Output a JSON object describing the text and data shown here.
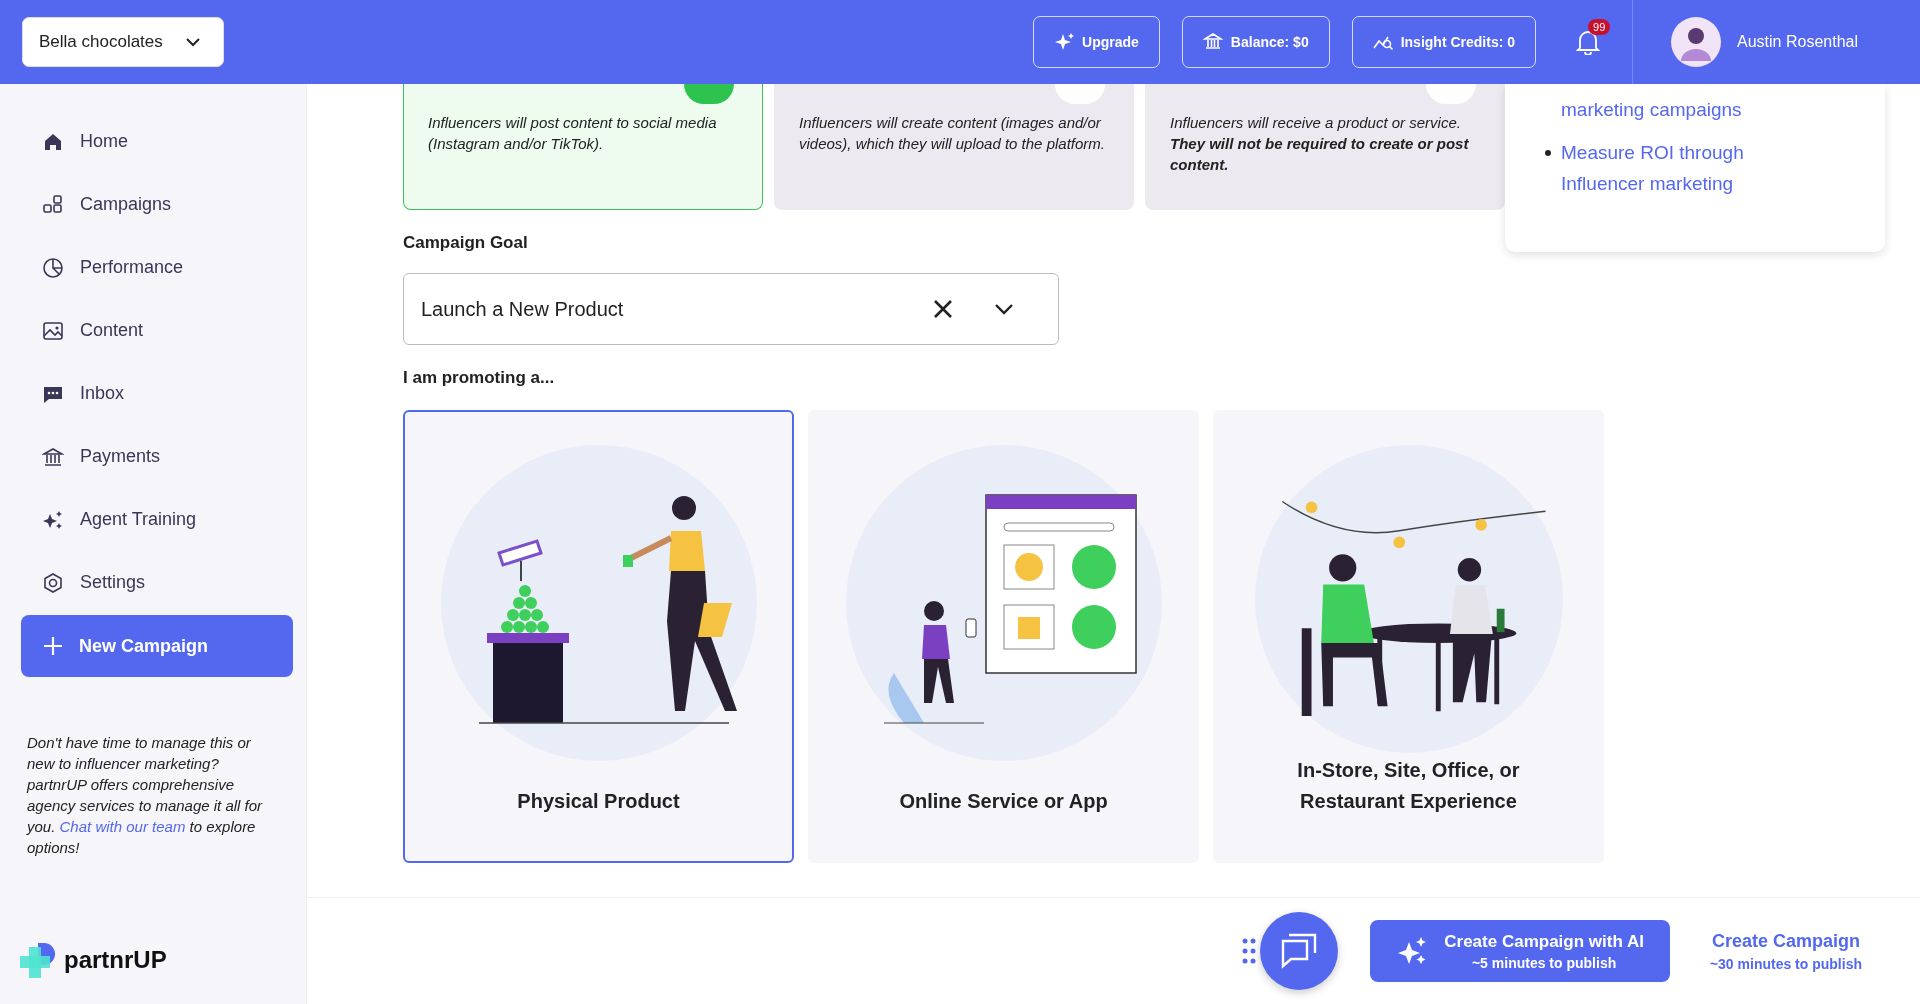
{
  "brand_selector": {
    "value": "Bella chocolates"
  },
  "top_bar": {
    "buttons": [
      {
        "label": "Upgrade",
        "kind": "upgrade"
      },
      {
        "label": "Balance: $0",
        "kind": "balance"
      },
      {
        "label": "Insight Credits: 0",
        "kind": "insight"
      }
    ],
    "notifications": {
      "count": "99"
    },
    "user": {
      "name": "Austin Rosenthal"
    }
  },
  "sidebar": {
    "items": [
      {
        "label": "Home",
        "kind": "home"
      },
      {
        "label": "Campaigns",
        "kind": "campaigns"
      },
      {
        "label": "Performance",
        "kind": "performance"
      },
      {
        "label": "Content",
        "kind": "content"
      },
      {
        "label": "Inbox",
        "kind": "inbox"
      },
      {
        "label": "Payments",
        "kind": "payments"
      },
      {
        "label": "Agent Training",
        "kind": "training"
      },
      {
        "label": "Settings",
        "kind": "settings"
      }
    ],
    "new_campaign": "New Campaign",
    "promo": {
      "text_before": "Don't have time to manage this or new to influencer marketing? partnrUP offers comprehensive agency services to manage it all for you. ",
      "link": "Chat with our team",
      "text_after": " to explore options!"
    },
    "logo": "partnrUP"
  },
  "campaign_types": [
    {
      "description": "Influencers will post content to social media (Instagram and/or TikTok).",
      "selected": true
    },
    {
      "description": "Influencers will create content (images and/or videos), which they will upload to the platform.",
      "selected": false
    },
    {
      "description": "Influencers will receive a product or service. **They will not be required to create or post content.**",
      "selected": false
    }
  ],
  "help_panel": {
    "links": [
      {
        "text": "marketing campaigns",
        "bullet": false
      },
      {
        "text": "Measure ROI through Influencer marketing",
        "bullet": true
      }
    ]
  },
  "campaign_goal": {
    "label": "Campaign Goal",
    "value": "Launch a New Product"
  },
  "promoting": {
    "label": "I am promoting a...",
    "options": [
      {
        "label": "Physical Product",
        "kind": "physical",
        "selected": true
      },
      {
        "label": "Online Service or App",
        "kind": "online",
        "selected": false
      },
      {
        "label": "In-Store, Site, Office, or Restaurant Experience",
        "kind": "instore",
        "selected": false
      }
    ]
  },
  "footer": {
    "ai_button": {
      "label": "Create Campaign with AI",
      "sub": "~5 minutes to publish"
    },
    "manual_button": {
      "label": "Create Campaign",
      "sub": "~30 minutes to publish"
    }
  }
}
